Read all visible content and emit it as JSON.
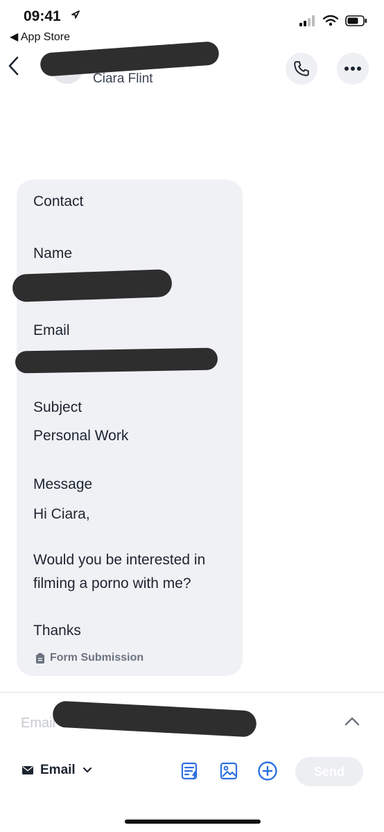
{
  "status": {
    "time": "09:41",
    "back_app": "◀ App Store"
  },
  "header": {
    "contact_name": "Ciara Flint",
    "icons": {
      "back": "chevron-left-icon",
      "call": "phone-icon",
      "more": "ellipsis-icon"
    }
  },
  "message": {
    "heading": "Contact",
    "name_label": "Name",
    "email_label": "Email",
    "subject_label": "Subject",
    "subject_value": "Personal Work",
    "message_label": "Message",
    "message_lines": [
      "Hi Ciara,",
      "Would you be interested in",
      "filming a porno with me?",
      "Thanks"
    ],
    "footer": "Form Submission"
  },
  "composer": {
    "placeholder": "Email",
    "channel_label": "Email",
    "send_label": "Send"
  },
  "colors": {
    "accent": "#2c6fe0",
    "card": "#f0f1f5",
    "text": "#1c2430"
  }
}
